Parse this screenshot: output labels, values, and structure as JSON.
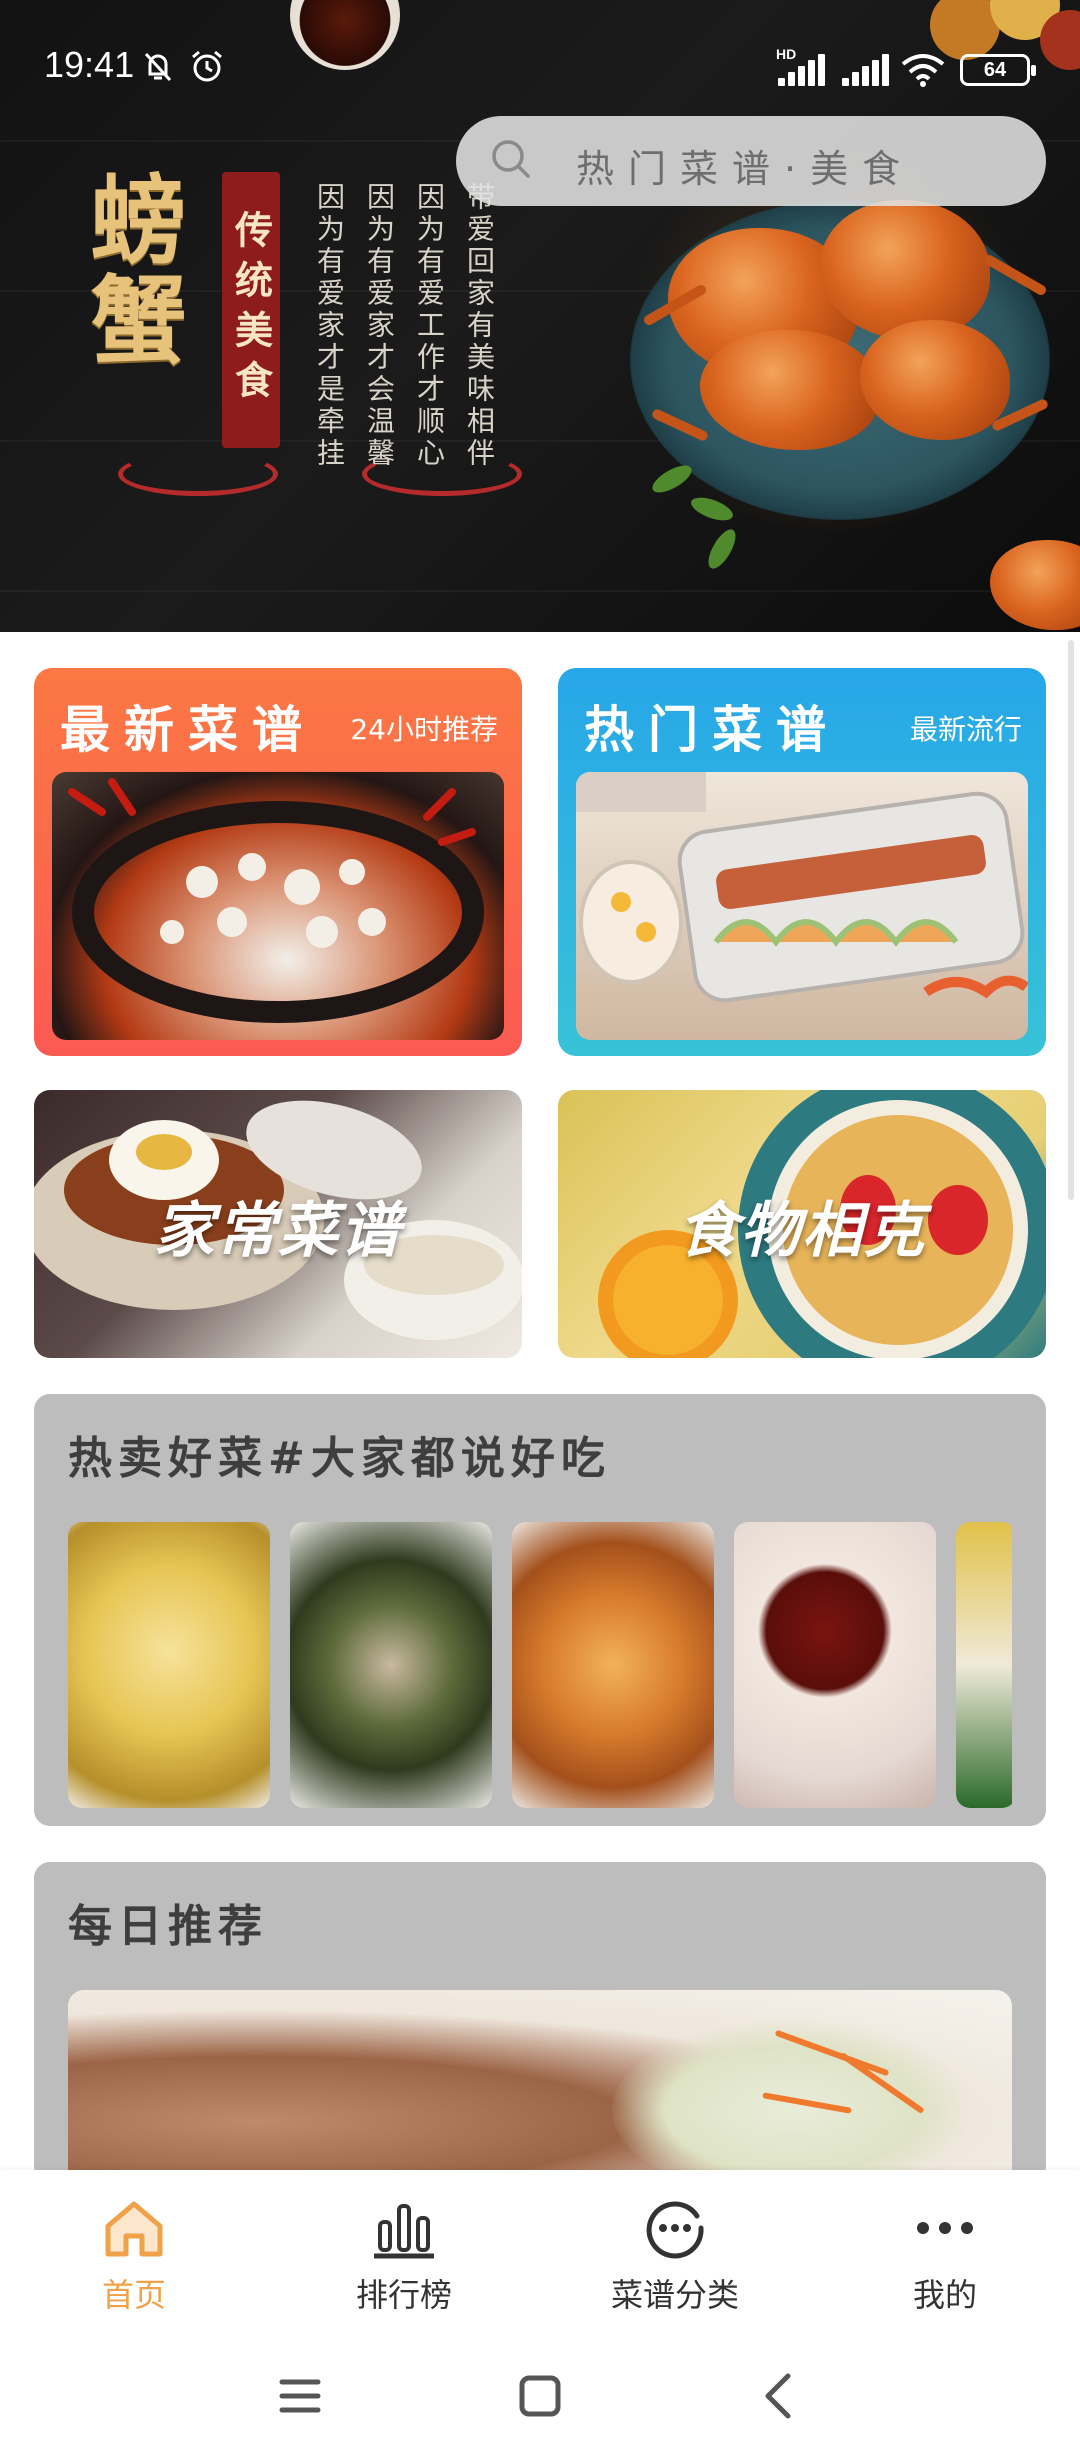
{
  "status_bar": {
    "time": "19:41",
    "network_label": "HD",
    "battery": "64"
  },
  "banner": {
    "title": "螃蟹",
    "seal": "传统美食",
    "lines": [
      "带爱回家有美味相伴",
      "因为有爱工作才顺心",
      "因为有爱家才会温馨",
      "因为有爱家才是牵挂"
    ]
  },
  "search": {
    "placeholder": "热门菜谱·美食"
  },
  "cards": {
    "latest": {
      "title": "最新菜谱",
      "subtitle": "24小时推荐"
    },
    "hot": {
      "title": "热门菜谱",
      "subtitle": "最新流行"
    },
    "home": {
      "label": "家常菜谱"
    },
    "clash": {
      "label": "食物相克"
    }
  },
  "hot_selling": {
    "title": "热卖好菜#大家都说好吃"
  },
  "daily": {
    "title": "每日推荐"
  },
  "tabs": [
    {
      "label": "首页",
      "icon": "home-icon",
      "active": true
    },
    {
      "label": "排行榜",
      "icon": "bar-chart-icon",
      "active": false
    },
    {
      "label": "菜谱分类",
      "icon": "category-icon",
      "active": false
    },
    {
      "label": "我的",
      "icon": "more-icon",
      "active": false
    }
  ],
  "colors": {
    "accent": "#f0a24a",
    "latest_card": "#fb6a4a",
    "hot_card": "#2fb5e0",
    "section_bg": "#bdbdbd"
  }
}
